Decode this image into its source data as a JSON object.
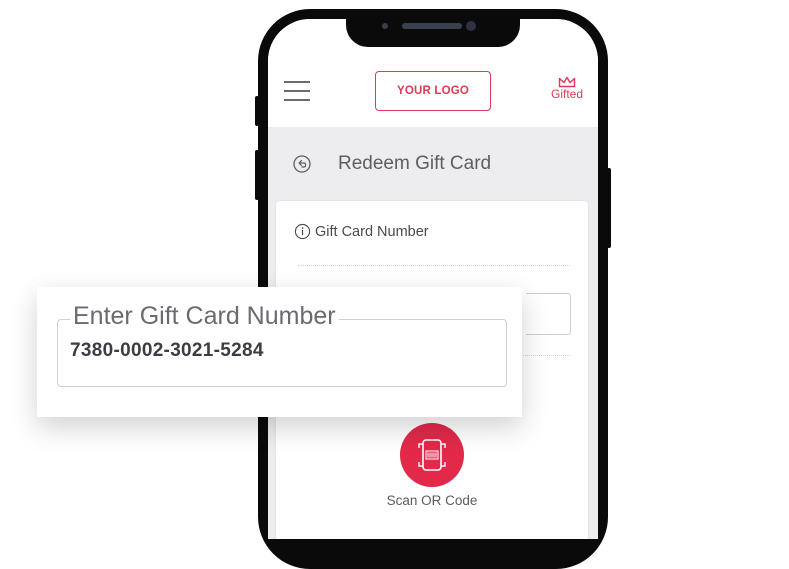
{
  "header": {
    "logo_label": "YOUR LOGO",
    "brand_label": "Gifted",
    "menu_icon": "hamburger-icon",
    "brand_icon": "crown-icon"
  },
  "page": {
    "title": "Redeem Gift Card",
    "back_icon": "back-icon"
  },
  "card": {
    "section_label": "Gift Card Number",
    "info_icon": "info-icon",
    "scan_label": "Scan OR Code",
    "scan_icon": "barcode-scan-icon"
  },
  "zoom": {
    "field_label": "Enter Gift Card Number",
    "field_value": "7380-0002-3021-5284"
  },
  "colors": {
    "accent": "#e03a55",
    "scan_button": "#e2294a",
    "screen_bg": "#ededef"
  }
}
